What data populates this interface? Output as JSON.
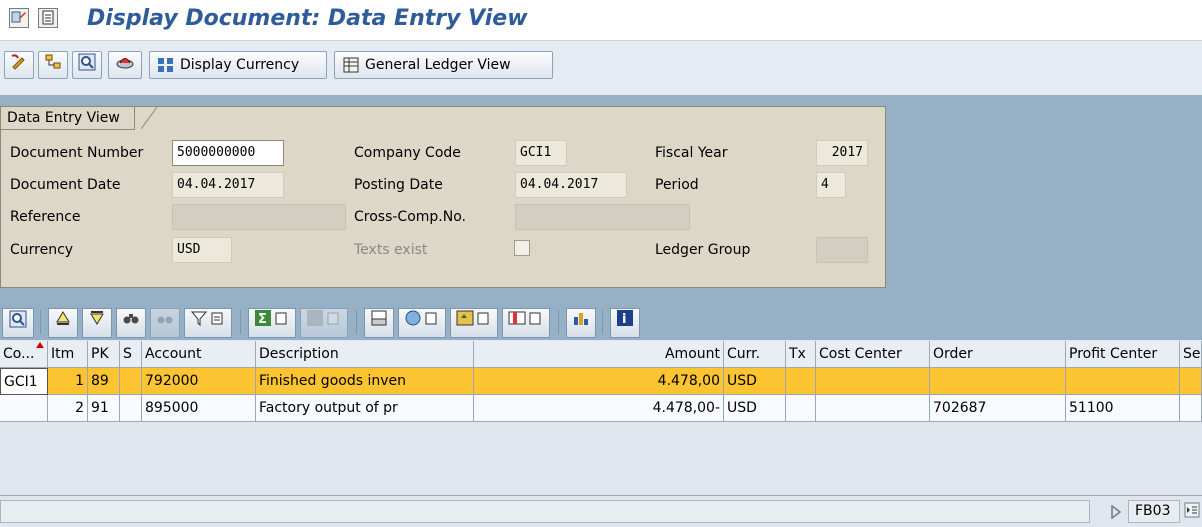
{
  "window": {
    "title": "Display Document: Data Entry View"
  },
  "toolbar": {
    "display_currency_label": "Display Currency",
    "gl_view_label": "General Ledger View"
  },
  "header": {
    "tab_label": "Data Entry View",
    "fields": {
      "document_number": {
        "label": "Document Number",
        "value": "5000000000"
      },
      "company_code": {
        "label": "Company Code",
        "value": "GCI1"
      },
      "fiscal_year": {
        "label": "Fiscal Year",
        "value": "2017"
      },
      "document_date": {
        "label": "Document Date",
        "value": "04.04.2017"
      },
      "posting_date": {
        "label": "Posting Date",
        "value": "04.04.2017"
      },
      "period": {
        "label": "Period",
        "value": "4"
      },
      "reference": {
        "label": "Reference",
        "value": ""
      },
      "cross_comp": {
        "label": "Cross-Comp.No.",
        "value": ""
      },
      "currency": {
        "label": "Currency",
        "value": "USD"
      },
      "texts_exist": {
        "label": "Texts exist"
      },
      "ledger_group": {
        "label": "Ledger Group",
        "value": ""
      }
    }
  },
  "grid": {
    "columns": [
      "Co...",
      "Itm",
      "PK",
      "S",
      "Account",
      "Description",
      "Amount",
      "Curr.",
      "Tx",
      "Cost Center",
      "Order",
      "Profit Center",
      "Se"
    ],
    "rows": [
      {
        "co": "GCI1",
        "itm": "1",
        "pk": "89",
        "s": "",
        "account": "792000",
        "description": "Finished goods inven",
        "amount": "4.478,00",
        "curr": "USD",
        "tx": "",
        "cost_center": "",
        "order": "",
        "profit_center": "",
        "se": ""
      },
      {
        "co": "",
        "itm": "2",
        "pk": "91",
        "s": "",
        "account": "895000",
        "description": "Factory output of pr",
        "amount": "4.478,00-",
        "curr": "USD",
        "tx": "",
        "cost_center": "",
        "order": "702687",
        "profit_center": "51100",
        "se": ""
      }
    ]
  },
  "status": {
    "transaction": "FB03"
  },
  "colors": {
    "title_blue": "#2e5b9a",
    "selected_row": "#fdc431",
    "panel_bg": "#dcd7c6",
    "blue_area": "#96b0c6"
  }
}
